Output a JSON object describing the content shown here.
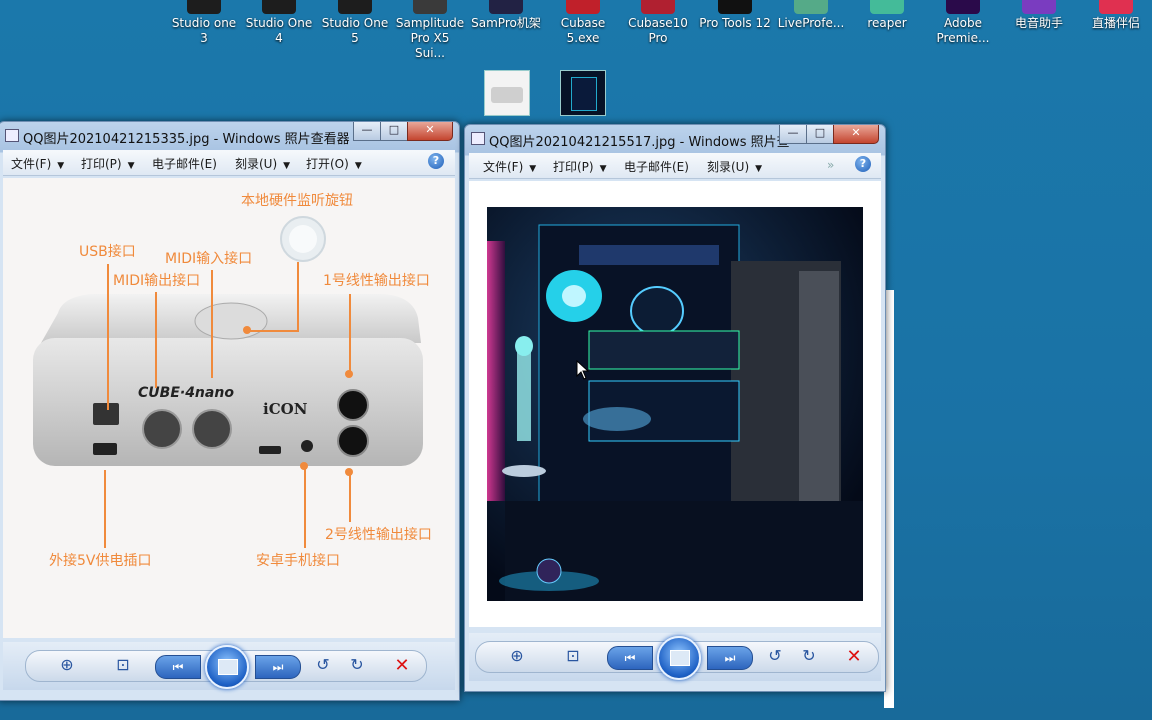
{
  "desktop": {
    "icons": [
      {
        "label": "Studio one 3",
        "color": "#1d1d1d"
      },
      {
        "label": "Studio One 4",
        "color": "#1d1d1d"
      },
      {
        "label": "Studio One 5",
        "color": "#1d1d1d"
      },
      {
        "label": "Samplitude Pro X5 Sui...",
        "color": "#3a3a3a"
      },
      {
        "label": "SamPro机架",
        "color": "#224"
      },
      {
        "label": "Cubase 5.exe",
        "color": "#c0202a"
      },
      {
        "label": "Cubase10 Pro",
        "color": "#b02030"
      },
      {
        "label": "Pro Tools 12",
        "color": "#111"
      },
      {
        "label": "LiveProfe...",
        "color": "#5a8"
      },
      {
        "label": "reaper",
        "color": "#4b9"
      },
      {
        "label": "Adobe Premie...",
        "color": "#2a0a4a"
      },
      {
        "label": "电音助手",
        "color": "#7a3cc0"
      },
      {
        "label": "直播伴侣",
        "color": "#e03050"
      }
    ]
  },
  "window1": {
    "title": "QQ图片20210421215335.jpg - Windows 照片查看器",
    "menus": [
      "文件(F)",
      "打印(P)",
      "电子邮件(E)",
      "刻录(U)",
      "打开(O)"
    ],
    "image": {
      "brand": "CUBE·4nano",
      "logo": "iCON",
      "callouts": {
        "monitor_knob": "本地硬件监听旋钮",
        "usb": "USB接口",
        "midi_in": "MIDI输入接口",
        "midi_out": "MIDI输出接口",
        "line_out_1": "1号线性输出接口",
        "power_5v": "外接5V供电插口",
        "android": "安卓手机接口",
        "line_out_2": "2号线性输出接口"
      }
    }
  },
  "window2": {
    "title": "QQ图片20210421215517.jpg - Windows 照片查...",
    "menus": [
      "文件(F)",
      "打印(P)",
      "电子邮件(E)",
      "刻录(U)"
    ]
  },
  "controls": {
    "close": "✕",
    "minimize": "—",
    "maximize": "□",
    "help": "?"
  },
  "colors": {
    "callout": "#f08a3c",
    "desktop": "#1a72a5"
  }
}
